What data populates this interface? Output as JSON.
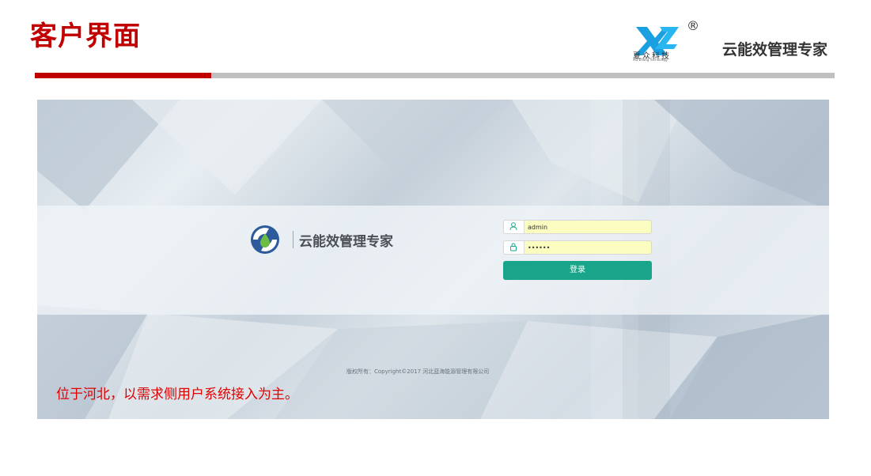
{
  "slide": {
    "title": "客户界面",
    "reg_mark": "®",
    "brand_logo_text": "夏众科技",
    "brand_logo_sub": "Xia Zhong Technology",
    "product_name": "云能效管理专家",
    "accent_color": "#c00000"
  },
  "login_screen": {
    "app_name": "云能效管理专家",
    "username": {
      "value": "admin",
      "icon": "user-icon"
    },
    "password": {
      "value": "••••••",
      "icon": "lock-icon"
    },
    "login_button": "登录",
    "button_color": "#18a589",
    "copyright": "版权所有：Copyright©2017 河北蓝海能源管理有限公司"
  },
  "caption": "位于河北，以需求侧用户系统接入为主。"
}
